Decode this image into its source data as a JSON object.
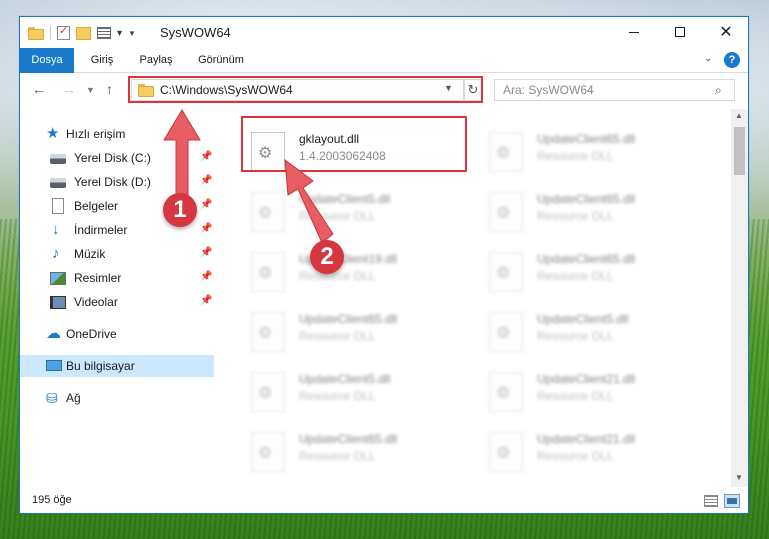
{
  "window": {
    "title": "SysWOW64"
  },
  "ribbon": {
    "tabs": [
      "Dosya",
      "Giriş",
      "Paylaş",
      "Görünüm"
    ]
  },
  "address": {
    "path": "C:\\Windows\\SysWOW64"
  },
  "search": {
    "placeholder": "Ara: SysWOW64"
  },
  "sidebar": {
    "items": [
      {
        "label": "Hızlı erişim",
        "icon": "star-icon"
      },
      {
        "label": "Yerel Disk (C:)",
        "icon": "drive-icon",
        "pinned": true
      },
      {
        "label": "Yerel Disk (D:)",
        "icon": "drive-icon",
        "pinned": true
      },
      {
        "label": "Belgeler",
        "icon": "documents-icon",
        "pinned": true
      },
      {
        "label": "İndirmeler",
        "icon": "download-icon",
        "pinned": true
      },
      {
        "label": "Müzik",
        "icon": "music-icon",
        "pinned": true
      },
      {
        "label": "Resimler",
        "icon": "pictures-icon",
        "pinned": true
      },
      {
        "label": "Videolar",
        "icon": "videos-icon",
        "pinned": true
      },
      {
        "label": "OneDrive",
        "icon": "cloud-icon"
      },
      {
        "label": "Bu bilgisayar",
        "icon": "computer-icon",
        "selected": true
      },
      {
        "label": "Ağ",
        "icon": "network-icon"
      }
    ]
  },
  "files": [
    {
      "name": "gklayout.dll",
      "sub": "1.4.2003062408",
      "highlighted": true
    },
    {
      "name": "UpdateClient65.dll",
      "sub": "Resource DLL"
    },
    {
      "name": "UpdateClient5.dll",
      "sub": "Resource DLL"
    },
    {
      "name": "UpdateClient65.dll",
      "sub": "Resource DLL"
    },
    {
      "name": "UpdateClient19.dll",
      "sub": "Resource DLL"
    },
    {
      "name": "UpdateClient65.dll",
      "sub": "Resource DLL"
    },
    {
      "name": "UpdateClient65.dll",
      "sub": "Resource DLL"
    },
    {
      "name": "UpdateClient5.dll",
      "sub": "Resource DLL"
    },
    {
      "name": "UpdateClient5.dll",
      "sub": "Resource DLL"
    },
    {
      "name": "UpdateClient21.dll",
      "sub": "Resource DLL"
    },
    {
      "name": "UpdateClient65.dll",
      "sub": "Resource DLL"
    },
    {
      "name": "UpdateClient21.dll",
      "sub": "Resource DLL"
    }
  ],
  "status": {
    "item_count": "195 öğe"
  },
  "annotations": {
    "badge1": "1",
    "badge2": "2",
    "color": "#d6363f"
  }
}
